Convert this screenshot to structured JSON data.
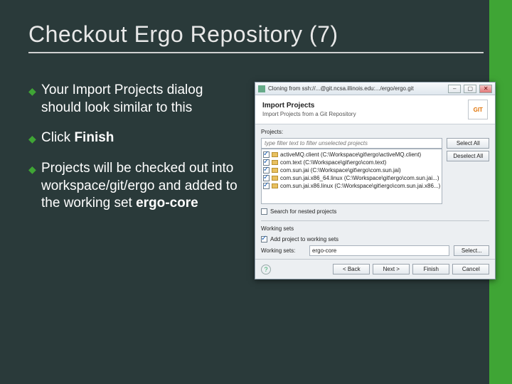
{
  "slide": {
    "title": "Checkout Ergo Repository (7)",
    "bullets": [
      {
        "pre": "Your Import Projects dialog should look similar to this",
        "bold": "",
        "post": ""
      },
      {
        "pre": "Click ",
        "bold": "Finish",
        "post": ""
      },
      {
        "pre": "Projects will be checked out into workspace/git/ergo and added to the working set ",
        "bold": "ergo-core",
        "post": ""
      }
    ]
  },
  "dialog": {
    "window_title": "Cloning from ssh://...@git.ncsa.illinois.edu:.../ergo/ergo.git",
    "window_buttons": {
      "min": "–",
      "max": "▢",
      "close": "✕"
    },
    "header_title": "Import Projects",
    "header_sub": "Import Projects from a Git Repository",
    "git_label": "GIT",
    "projects_label": "Projects:",
    "filter_placeholder": "type filter text to filter unselected projects",
    "projects": [
      {
        "checked": true,
        "label": "activeMQ.client (C:\\Workspace\\git\\ergo\\activeMQ.client)"
      },
      {
        "checked": true,
        "label": "com.text (C:\\Workspace\\git\\ergo\\com.text)"
      },
      {
        "checked": true,
        "label": "com.sun.jai (C:\\Workspace\\git\\ergo\\com.sun.jai)"
      },
      {
        "checked": true,
        "label": "com.sun.jai.x86_64.linux (C:\\Workspace\\git\\ergo\\com.sun.jai...)"
      },
      {
        "checked": true,
        "label": "com.sun.jai.x86.linux (C:\\Workspace\\git\\ergo\\com.sun.jai.x86...)"
      }
    ],
    "side_buttons": {
      "select_all": "Select All",
      "deselect_all": "Deselect All"
    },
    "search_nested": {
      "checked": false,
      "label": "Search for nested projects"
    },
    "working_sets": {
      "group_label": "Working sets",
      "add_checkbox": {
        "checked": true,
        "label": "Add project to working sets"
      },
      "field_label": "Working sets:",
      "value": "ergo-core",
      "select_btn": "Select..."
    },
    "footer": {
      "help": "?",
      "back": "< Back",
      "next": "Next >",
      "finish": "Finish",
      "cancel": "Cancel"
    }
  }
}
